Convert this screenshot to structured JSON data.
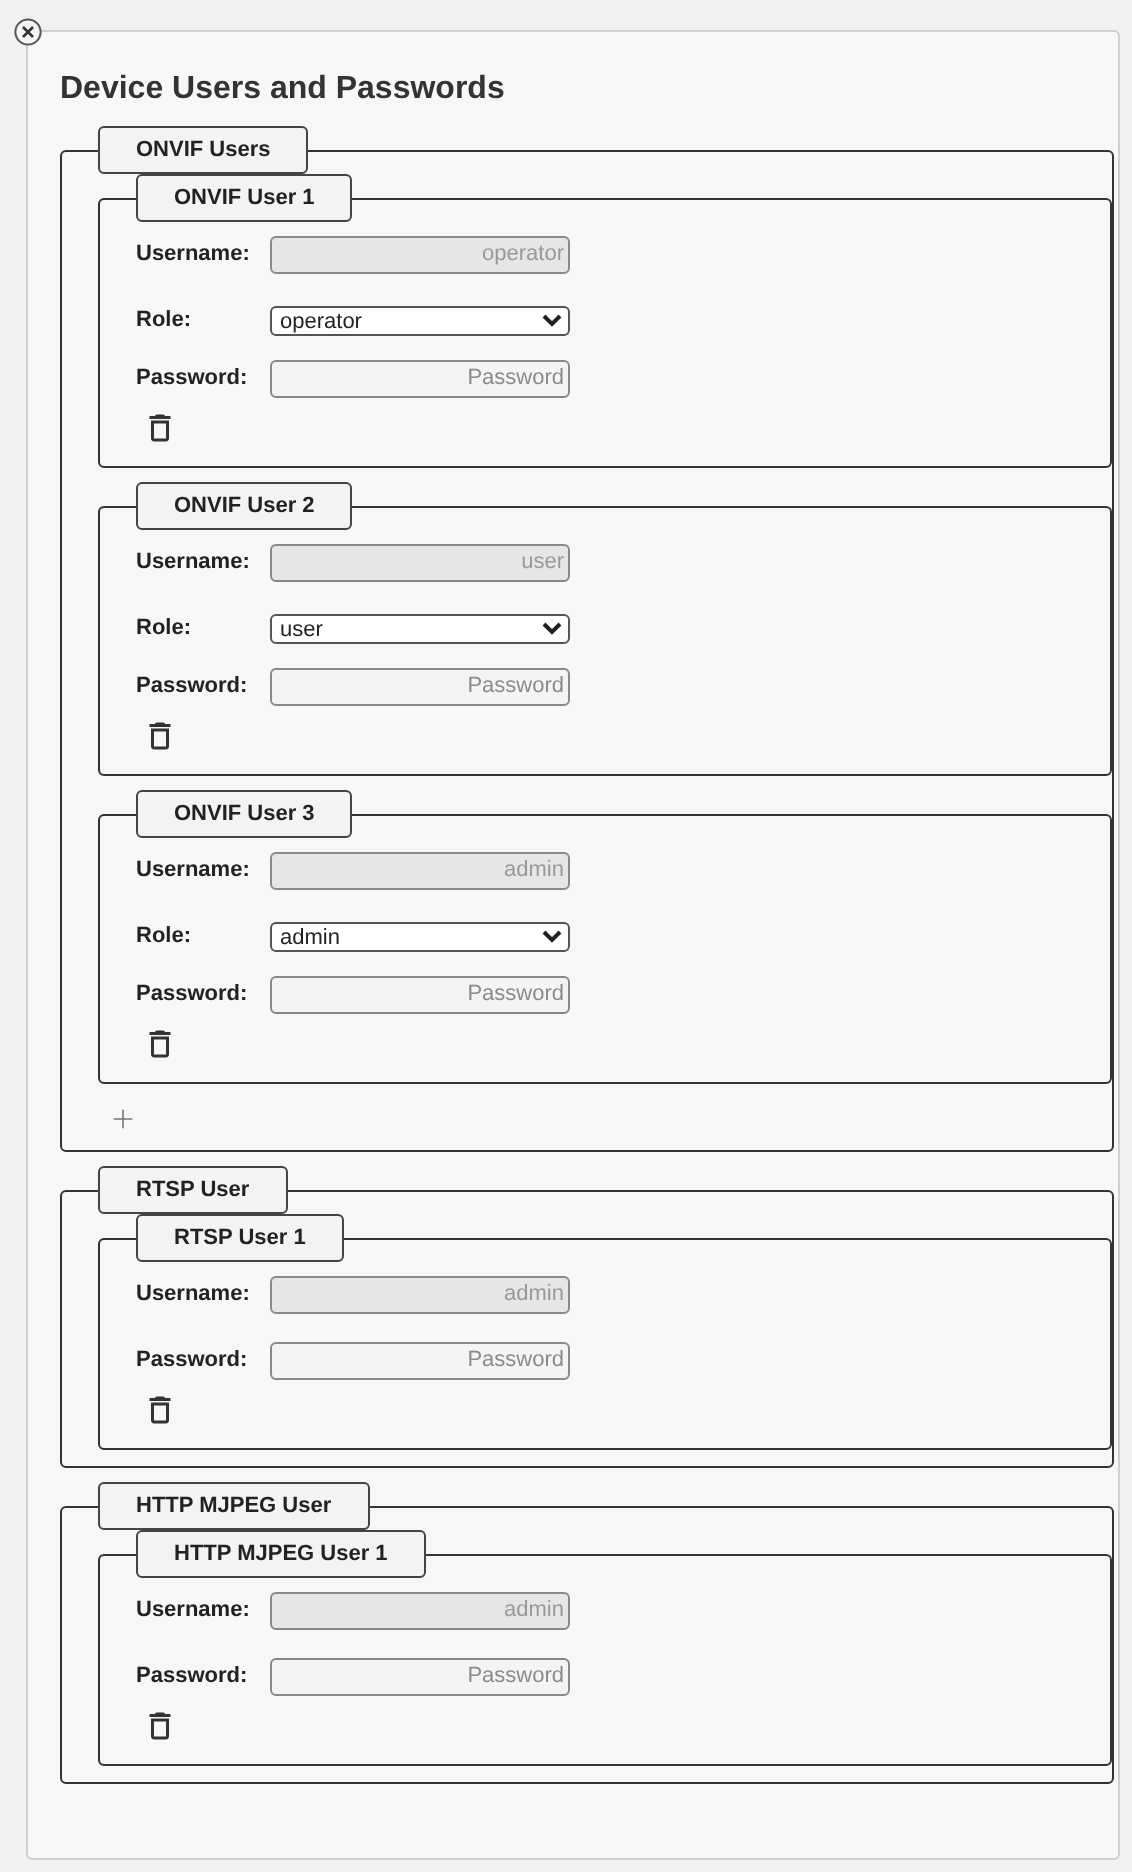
{
  "title": "Device Users and Passwords",
  "groups": [
    {
      "legend": "ONVIF Users",
      "addable": true,
      "users": [
        {
          "legend": "ONVIF User 1",
          "fields": [
            {
              "kind": "text",
              "label": "Username:",
              "value": "operator",
              "disabled": true
            },
            {
              "kind": "select",
              "label": "Role:",
              "value": "operator"
            },
            {
              "kind": "password",
              "label": "Password:",
              "placeholder": "Password",
              "disabled": false
            }
          ]
        },
        {
          "legend": "ONVIF User 2",
          "fields": [
            {
              "kind": "text",
              "label": "Username:",
              "value": "user",
              "disabled": true
            },
            {
              "kind": "select",
              "label": "Role:",
              "value": "user"
            },
            {
              "kind": "password",
              "label": "Password:",
              "placeholder": "Password",
              "disabled": false
            }
          ]
        },
        {
          "legend": "ONVIF User 3",
          "fields": [
            {
              "kind": "text",
              "label": "Username:",
              "value": "admin",
              "disabled": true
            },
            {
              "kind": "select",
              "label": "Role:",
              "value": "admin"
            },
            {
              "kind": "password",
              "label": "Password:",
              "placeholder": "Password",
              "disabled": false
            }
          ]
        }
      ]
    },
    {
      "legend": "RTSP User",
      "addable": false,
      "users": [
        {
          "legend": "RTSP User 1",
          "fields": [
            {
              "kind": "text",
              "label": "Username:",
              "value": "admin",
              "disabled": true
            },
            {
              "kind": "password",
              "label": "Password:",
              "placeholder": "Password",
              "disabled": false
            }
          ]
        }
      ]
    },
    {
      "legend": "HTTP MJPEG User",
      "addable": false,
      "users": [
        {
          "legend": "HTTP MJPEG User 1",
          "fields": [
            {
              "kind": "text",
              "label": "Username:",
              "value": "admin",
              "disabled": true
            },
            {
              "kind": "password",
              "label": "Password:",
              "placeholder": "Password",
              "disabled": false
            }
          ]
        }
      ]
    }
  ]
}
